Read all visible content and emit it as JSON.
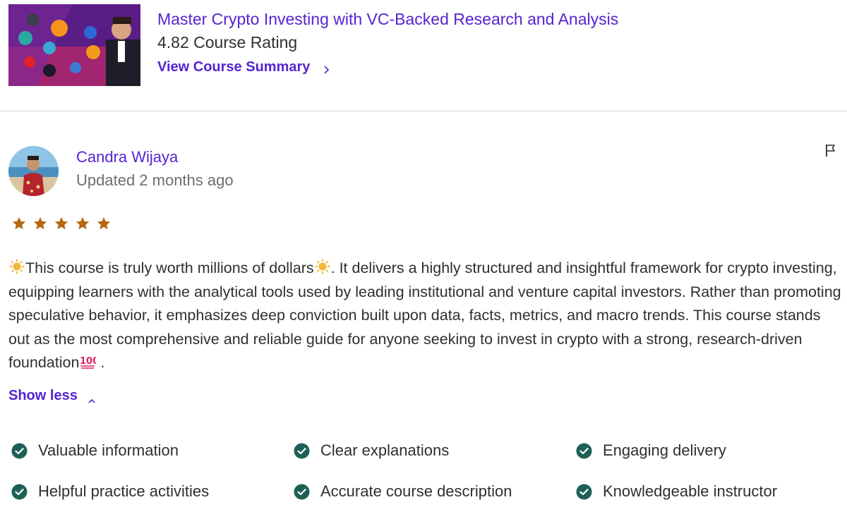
{
  "course": {
    "title": "Master Crypto Investing with VC-Backed Research and Analysis",
    "rating_text": "4.82 Course Rating",
    "summary_link": "View Course Summary"
  },
  "review": {
    "reviewer_name": "Candra Wijaya",
    "updated": "Updated 2 months ago",
    "rating": 5,
    "text_parts": [
      "This course is truly worth millions of dollars",
      ". It delivers a highly structured and insightful framework for crypto investing, equipping learners with the analytical tools used by leading institutional and venture capital investors. Rather than promoting speculative behavior, it emphasizes deep conviction built upon data, facts, metrics, and macro trends. This course stands out as the most comprehensive and reliable guide for anyone seeking to invest in crypto with a strong, research-driven foundation",
      " ."
    ],
    "show_less": "Show less",
    "tags": [
      "Valuable information",
      "Clear explanations",
      "Engaging delivery",
      "Helpful practice activities",
      "Accurate course description",
      "Knowledgeable instructor"
    ]
  },
  "colors": {
    "accent": "#5624d0",
    "star": "#b4690e",
    "check": "#1e6055",
    "text": "#2d2f31",
    "muted": "#6a6f73"
  },
  "icons": {
    "flag": "flag-icon",
    "star": "star-icon",
    "check": "check-circle-icon",
    "sun": "sun-emoji-icon",
    "hundred": "hundred-points-emoji-icon",
    "chevron_right": "chevron-right-icon",
    "chevron_up": "chevron-up-icon"
  }
}
